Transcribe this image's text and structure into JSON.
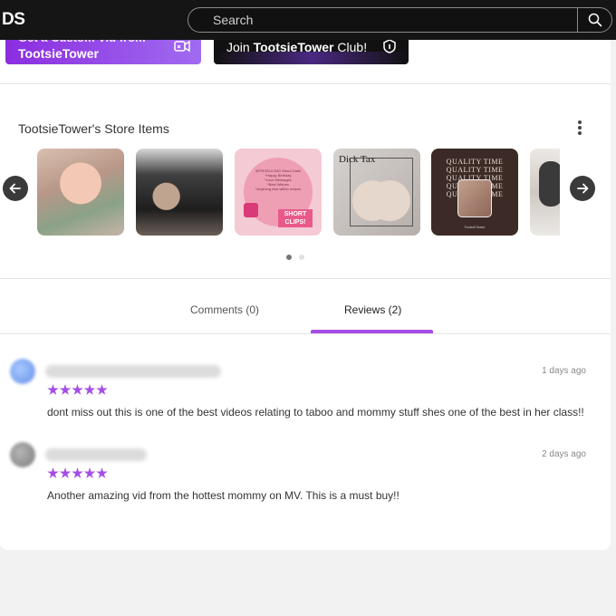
{
  "topbar": {
    "logo_text": "DS",
    "search_placeholder": "Search"
  },
  "promo": {
    "custom_line1": "Get a Custom Vid from",
    "custom_line2": "TootsieTower",
    "join_prefix": "Join ",
    "join_name": "TootsieTower",
    "join_suffix": " Club!"
  },
  "store": {
    "title": "TootsieTower's Store Items",
    "items": [
      {
        "thumb": 1,
        "caption": ""
      },
      {
        "thumb": 2,
        "caption": ""
      },
      {
        "thumb": 3,
        "caption": "INTRODUCING Shout Outs!\n*Happy Birthday\n*Love Messages\n*Best Wishes\n*Anything else within reason",
        "badge": "SHORT CLIPS!"
      },
      {
        "thumb": 4,
        "caption": "Dick Tax"
      },
      {
        "thumb": 5,
        "caption": "QUALITY TIME\nQUALITY TIME\nQUALITY TIME\nQUALITY TIME\nQUALITY TIME",
        "footer": "TootsieTower"
      },
      {
        "thumb": 6,
        "caption": ""
      }
    ],
    "page_count": 2,
    "active_page": 1
  },
  "tabs": {
    "comments_label": "Comments (0)",
    "reviews_label": "Reviews (2)",
    "active": "reviews"
  },
  "reviews": [
    {
      "rating": 5,
      "date": "1 days ago",
      "text": "dont miss out this is one of the best videos relating to taboo and mommy stuff shes one of the best in her class!!"
    },
    {
      "rating": 5,
      "date": "2 days ago",
      "text": "Another amazing vid from the hottest mommy on MV. This is a must buy!!"
    }
  ],
  "colors": {
    "accent": "#a44ee6",
    "topbar": "#151515"
  }
}
